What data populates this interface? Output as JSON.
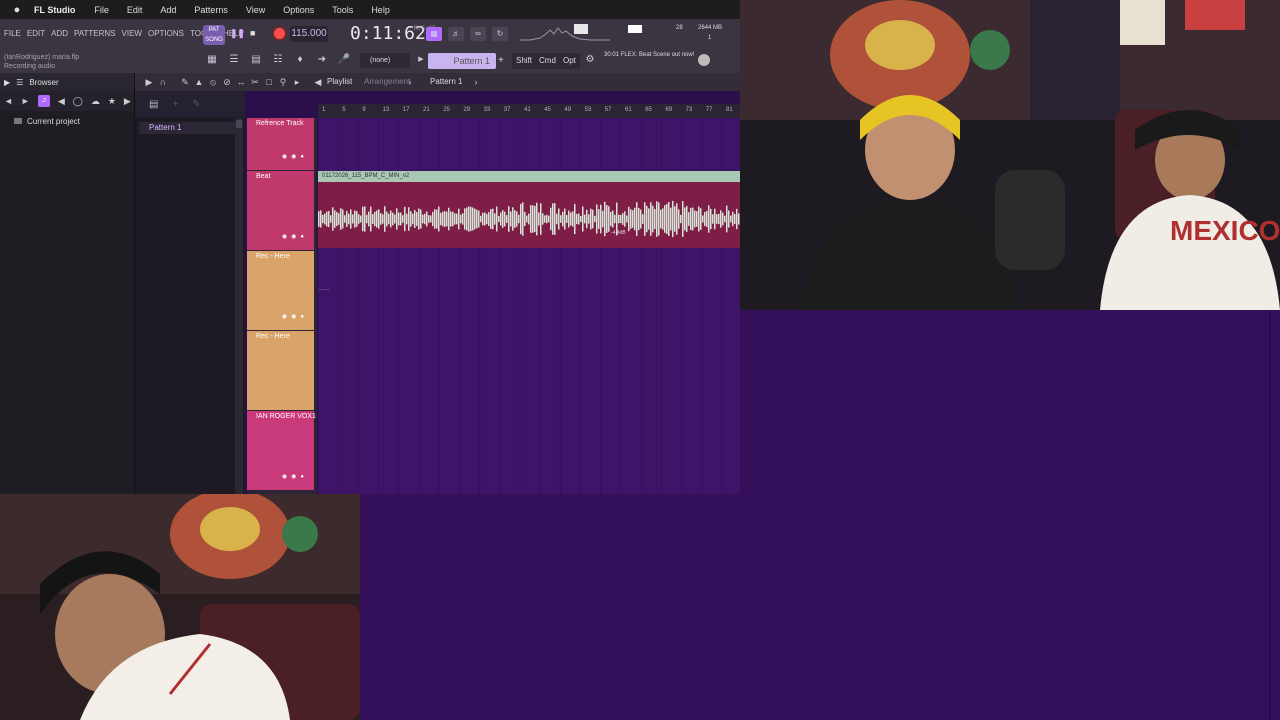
{
  "mac_menu": {
    "app_name": "FL Studio",
    "items": [
      "File",
      "Edit",
      "Add",
      "Patterns",
      "View",
      "Options",
      "Tools",
      "Help"
    ]
  },
  "fl_menu": [
    "FILE",
    "EDIT",
    "ADD",
    "PATTERNS",
    "VIEW",
    "OPTIONS",
    "TOOLS",
    "HELP"
  ],
  "project_info": {
    "line1": "(IanRodriguez) maria.flp",
    "line2": "Recording audio"
  },
  "transport": {
    "song_label": "PAT SONG",
    "tempo": "115.000",
    "time": "0:11:62",
    "time_unit": "M:S:CS"
  },
  "cpu": {
    "val1": "28",
    "val2": "2644 MB",
    "val3": "1"
  },
  "snap": {
    "value": "(none)"
  },
  "pattern_selector": {
    "value": "Pattern 1"
  },
  "modifiers": [
    "Shift",
    "Cmd",
    "Opt"
  ],
  "news": {
    "time": "30:01",
    "text": "FLEX: Beat Scene out now!"
  },
  "browser": {
    "title": "Browser",
    "item": "Current project"
  },
  "playlist": {
    "title": "Playlist",
    "subtitle": "Arrangement",
    "pattern": "Pattern 1",
    "pattern_list_item": "Pattern 1",
    "ruler": [
      "1",
      "5",
      "9",
      "13",
      "17",
      "21",
      "25",
      "29",
      "33",
      "37",
      "41",
      "45",
      "49",
      "53",
      "57",
      "61",
      "65",
      "69",
      "73",
      "77",
      "81"
    ]
  },
  "tracks": [
    {
      "name": "Refrence Track",
      "color": "#c0396d"
    },
    {
      "name": "Beat",
      "color": "#c0396d"
    },
    {
      "name": "Rec - Here",
      "color": "#d9a36a"
    },
    {
      "name": "Rec - Here",
      "color": "#d9a36a"
    },
    {
      "name": "IAN ROGER VOX1",
      "color": "#c93a7a"
    }
  ],
  "clip": {
    "name": "01172026_115_BPM_C_MIN_v2",
    "gain_label": "-4.4dB"
  },
  "colors": {
    "accent": "#b06aff",
    "grid_bg": "#3e1468",
    "page_bg": "#34105a"
  }
}
